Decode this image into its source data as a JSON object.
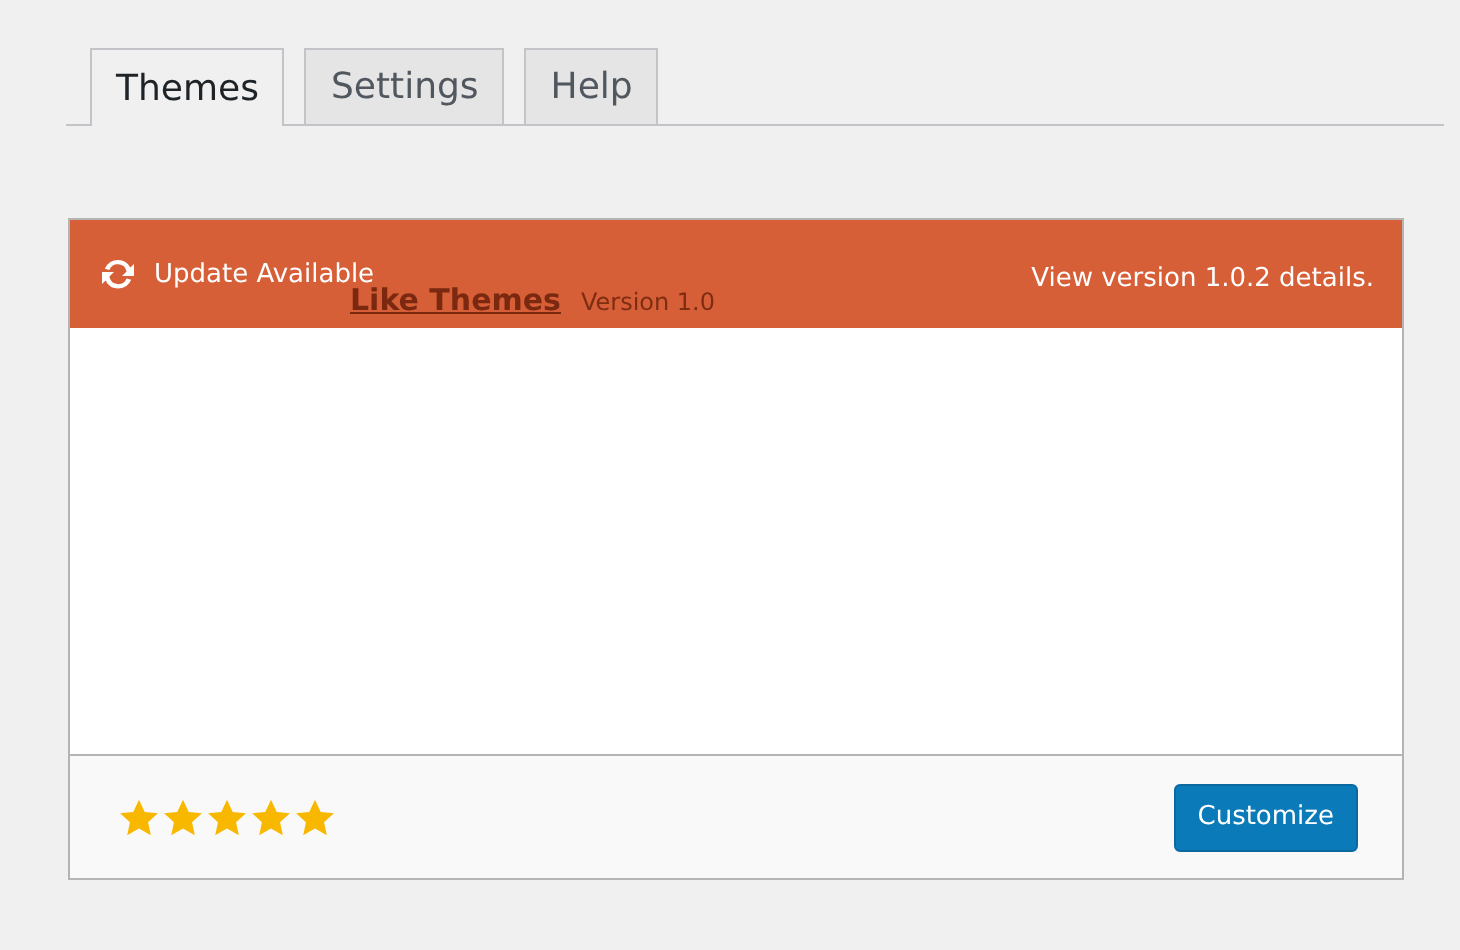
{
  "tabs": [
    {
      "label": "Themes",
      "selected": true
    },
    {
      "label": "Settings",
      "selected": false
    },
    {
      "label": "Help",
      "selected": false
    }
  ],
  "theme_card": {
    "update_notice": "Update Available",
    "details_link": "View version 1.0.2 details.",
    "theme_name": "Like Themes",
    "version": "Version 1.0",
    "stars": 5,
    "customize_button": "Customize"
  }
}
